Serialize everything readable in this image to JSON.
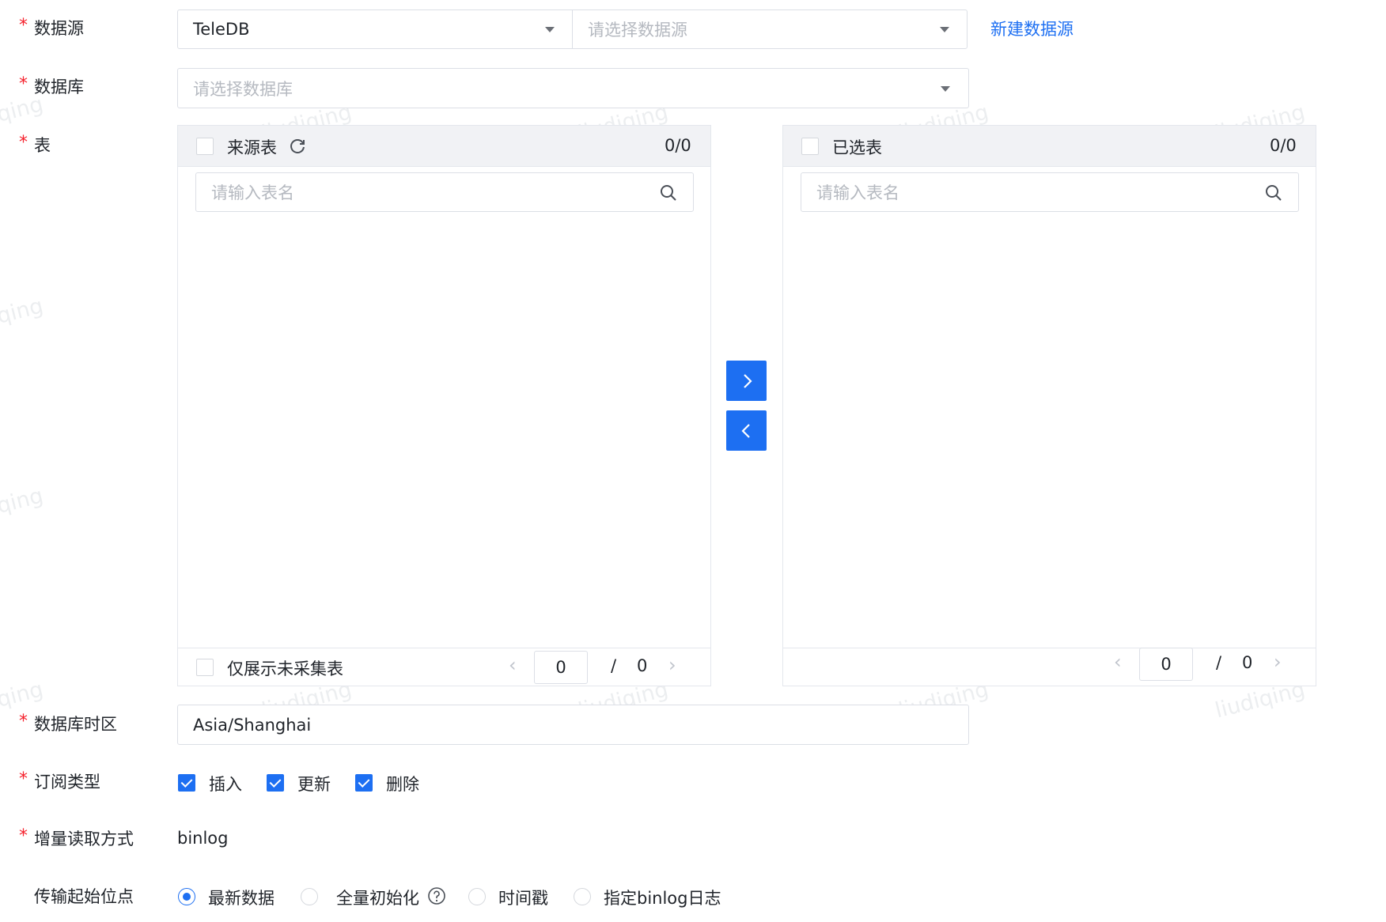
{
  "form": {
    "datasource": {
      "label": "数据源",
      "type_value": "TeleDB",
      "source_placeholder": "请选择数据源",
      "new_link": "新建数据源"
    },
    "database": {
      "label": "数据库",
      "placeholder": "请选择数据库"
    },
    "table": {
      "label": "表",
      "source_panel": {
        "title": "来源表",
        "count": "0/0",
        "search_placeholder": "请输入表名",
        "only_uncollected": "仅展示未采集表",
        "page_current": "0",
        "page_sep": "/",
        "page_total": "0"
      },
      "target_panel": {
        "title": "已选表",
        "count": "0/0",
        "search_placeholder": "请输入表名",
        "page_current": "0",
        "page_sep": "/",
        "page_total": "0"
      }
    },
    "timezone": {
      "label": "数据库时区",
      "value": "Asia/Shanghai"
    },
    "subscribe_type": {
      "label": "订阅类型",
      "options": [
        {
          "label": "插入",
          "checked": true
        },
        {
          "label": "更新",
          "checked": true
        },
        {
          "label": "删除",
          "checked": true
        }
      ]
    },
    "incremental_read": {
      "label": "增量读取方式",
      "value": "binlog"
    },
    "start_position": {
      "label": "传输起始位点",
      "options": [
        {
          "label": "最新数据",
          "selected": true
        },
        {
          "label": "全量初始化",
          "selected": false
        },
        {
          "label": "时间戳",
          "selected": false
        },
        {
          "label": "指定binlog日志",
          "selected": false
        }
      ]
    }
  },
  "watermark": "liudiqing",
  "colors": {
    "primary": "#1d6ff2",
    "required": "#f5222d",
    "panel_header": "#f1f2f5"
  }
}
